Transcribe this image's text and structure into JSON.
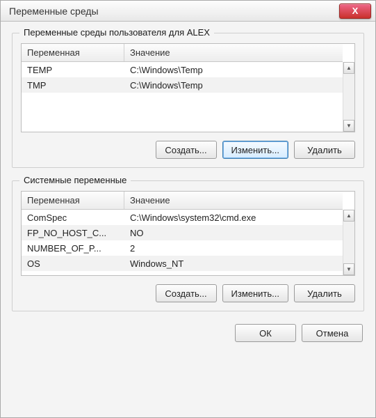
{
  "window": {
    "title": "Переменные среды",
    "close_icon": "X"
  },
  "user_vars": {
    "group_label": "Переменные среды пользователя для ALEX",
    "headers": {
      "var": "Переменная",
      "val": "Значение"
    },
    "rows": [
      {
        "var": "TEMP",
        "val": "C:\\Windows\\Temp"
      },
      {
        "var": "TMP",
        "val": "C:\\Windows\\Temp"
      }
    ],
    "buttons": {
      "create": "Создать...",
      "edit": "Изменить...",
      "delete": "Удалить"
    }
  },
  "system_vars": {
    "group_label": "Системные переменные",
    "headers": {
      "var": "Переменная",
      "val": "Значение"
    },
    "rows": [
      {
        "var": "ComSpec",
        "val": "C:\\Windows\\system32\\cmd.exe"
      },
      {
        "var": "FP_NO_HOST_C...",
        "val": "NO"
      },
      {
        "var": "NUMBER_OF_P...",
        "val": "2"
      },
      {
        "var": "OS",
        "val": "Windows_NT"
      }
    ],
    "buttons": {
      "create": "Создать...",
      "edit": "Изменить...",
      "delete": "Удалить"
    }
  },
  "dialog_buttons": {
    "ok": "ОК",
    "cancel": "Отмена"
  },
  "scroll": {
    "up": "▲",
    "down": "▼"
  }
}
